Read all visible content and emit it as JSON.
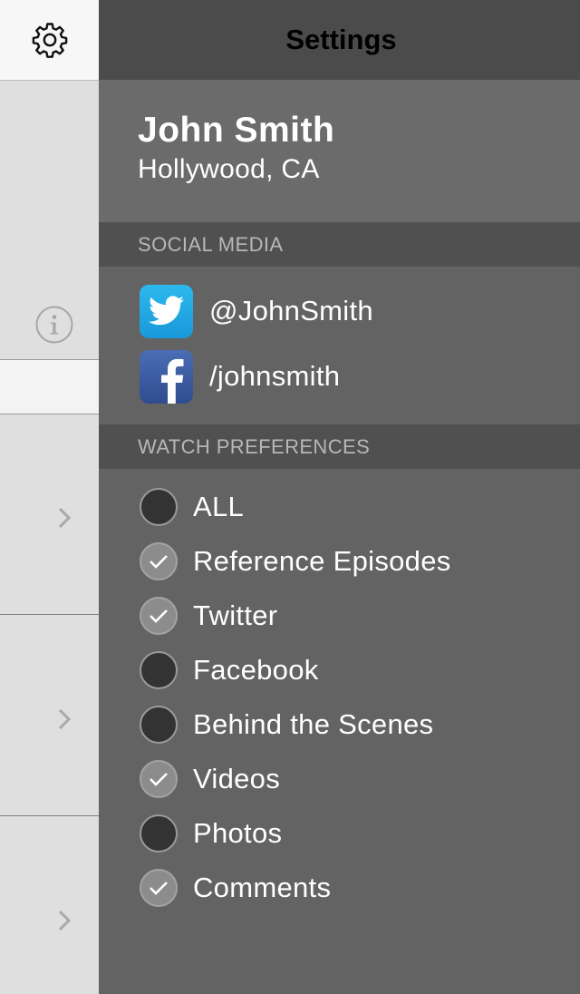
{
  "navbar": {
    "title": "Settings",
    "settings_icon": "gear-icon"
  },
  "side_strip": {
    "icons": [
      "info-icon",
      "chevron-right-icon",
      "chevron-right-icon",
      "chevron-right-icon"
    ]
  },
  "profile": {
    "name": "John Smith",
    "location": "Hollywood, CA"
  },
  "social_media": {
    "header": "SOCIAL MEDIA",
    "accounts": [
      {
        "service": "twitter",
        "icon": "twitter-logo-icon",
        "handle": "@JohnSmith",
        "color": "#22a9e6"
      },
      {
        "service": "facebook",
        "icon": "facebook-logo-icon",
        "handle": "/johnsmith",
        "color": "#3b5998"
      }
    ]
  },
  "watch_preferences": {
    "header": "WATCH PREFERENCES",
    "items": [
      {
        "label": "ALL",
        "checked": false
      },
      {
        "label": "Reference Episodes",
        "checked": true
      },
      {
        "label": "Twitter",
        "checked": true
      },
      {
        "label": "Facebook",
        "checked": false
      },
      {
        "label": "Behind the Scenes",
        "checked": false
      },
      {
        "label": "Videos",
        "checked": true
      },
      {
        "label": "Photos",
        "checked": false
      },
      {
        "label": "Comments",
        "checked": true
      }
    ]
  },
  "colors": {
    "panel_bg": "#636363",
    "navbar_bg": "#4b4b4b",
    "section_header_bg": "#505050",
    "toggle_off": "#333333",
    "toggle_on": "#8c8c8c"
  }
}
